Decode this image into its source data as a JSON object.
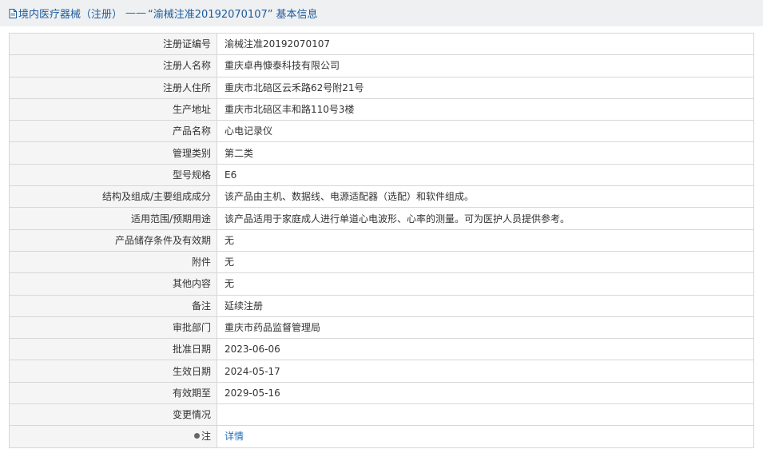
{
  "header": {
    "category": "境内医疗器械（注册）",
    "separator": "——",
    "registration_quoted": "“渝械注准20192070107”",
    "suffix": "基本信息",
    "icon": "document-icon"
  },
  "rows": [
    {
      "label": "注册证编号",
      "value": "渝械注准20192070107"
    },
    {
      "label": "注册人名称",
      "value": "重庆卓冉慷泰科技有限公司"
    },
    {
      "label": "注册人住所",
      "value": "重庆市北碚区云禾路62号附21号"
    },
    {
      "label": "生产地址",
      "value": "重庆市北碚区丰和路110号3楼"
    },
    {
      "label": "产品名称",
      "value": "心电记录仪"
    },
    {
      "label": "管理类别",
      "value": "第二类"
    },
    {
      "label": "型号规格",
      "value": "E6"
    },
    {
      "label": "结构及组成/主要组成成分",
      "value": "该产品由主机、数据线、电源适配器（选配）和软件组成。"
    },
    {
      "label": "适用范围/预期用途",
      "value": "该产品适用于家庭成人进行单道心电波形、心率的测量。可为医护人员提供参考。"
    },
    {
      "label": "产品储存条件及有效期",
      "value": "无"
    },
    {
      "label": "附件",
      "value": "无"
    },
    {
      "label": "其他内容",
      "value": "无"
    },
    {
      "label": "备注",
      "value": "延续注册"
    },
    {
      "label": "审批部门",
      "value": "重庆市药品监督管理局"
    },
    {
      "label": "批准日期",
      "value": "2023-06-06"
    },
    {
      "label": "生效日期",
      "value": "2024-05-17"
    },
    {
      "label": "有效期至",
      "value": "2029-05-16"
    },
    {
      "label": "变更情况",
      "value": ""
    }
  ],
  "note_row": {
    "label": "注",
    "link": "详情",
    "icon": "info-dot-icon"
  },
  "colors": {
    "title_bg": "#eef0f2",
    "title_text": "#1e5b9c",
    "label_bg": "#f5f5f5",
    "border": "#d7d7d7",
    "link": "#1e6fbb"
  }
}
